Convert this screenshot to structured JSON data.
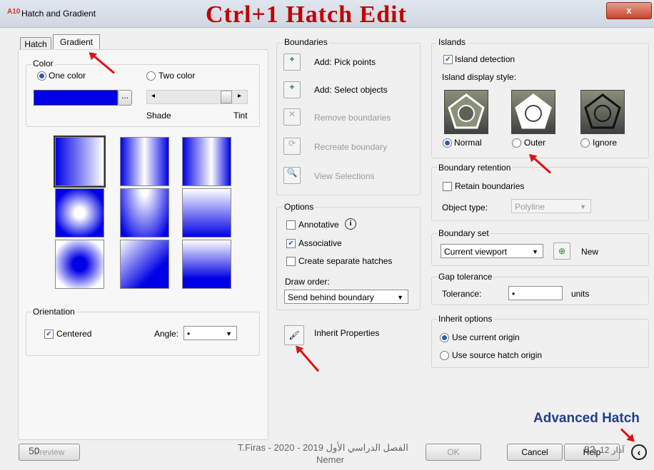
{
  "window": {
    "title": "Hatch and Gradient",
    "close_label": "x",
    "app_badge": "A10"
  },
  "slide_title": "Ctrl+1   Hatch Edit",
  "tabs": [
    {
      "label": "Hatch"
    },
    {
      "label": "Gradient"
    }
  ],
  "color": {
    "group_label": "Color",
    "one_color": "One color",
    "two_color": "Two color",
    "browse_label": "...",
    "shade": "Shade",
    "tint": "Tint",
    "color_hex": "#0000e6"
  },
  "orientation": {
    "group_label": "Orientation",
    "centered": "Centered",
    "angle_label": "Angle:",
    "angle_value": "•"
  },
  "boundaries": {
    "group_label": "Boundaries",
    "add_pick": "Add: Pick points",
    "add_select": "Add: Select objects",
    "remove": "Remove boundaries",
    "recreate": "Recreate boundary",
    "view": "View Selections"
  },
  "options": {
    "group_label": "Options",
    "annotative": "Annotative",
    "associative": "Associative",
    "separate": "Create separate hatches",
    "draw_order_label": "Draw order:",
    "draw_order_value": "Send behind boundary"
  },
  "inherit_label": "Inherit Properties",
  "islands": {
    "group_label": "Islands",
    "detection": "Island detection",
    "style_label": "Island display style:",
    "normal": "Normal",
    "outer": "Outer",
    "ignore": "Ignore"
  },
  "retention": {
    "group_label": "Boundary retention",
    "retain": "Retain boundaries",
    "type_label": "Object type:",
    "type_value": "Polyline"
  },
  "boundary_set": {
    "group_label": "Boundary set",
    "value": "Current viewport",
    "new_label": "New"
  },
  "gap": {
    "group_label": "Gap tolerance",
    "label": "Tolerance:",
    "value": "•",
    "units": "units"
  },
  "inherit_options": {
    "group_label": "Inherit options",
    "current": "Use current origin",
    "source": "Use source hatch origin"
  },
  "footer": {
    "preview": "Preview",
    "ok": "OK",
    "cancel": "Cancel",
    "help": "Help",
    "page_left": "50",
    "page_right": "82",
    "credit": "T.Firas  -  2020 - 2019 الفصل الدراسي الأول",
    "credit2": "Nemer",
    "date": "12 آذار",
    "advanced": "Advanced Hatch"
  }
}
